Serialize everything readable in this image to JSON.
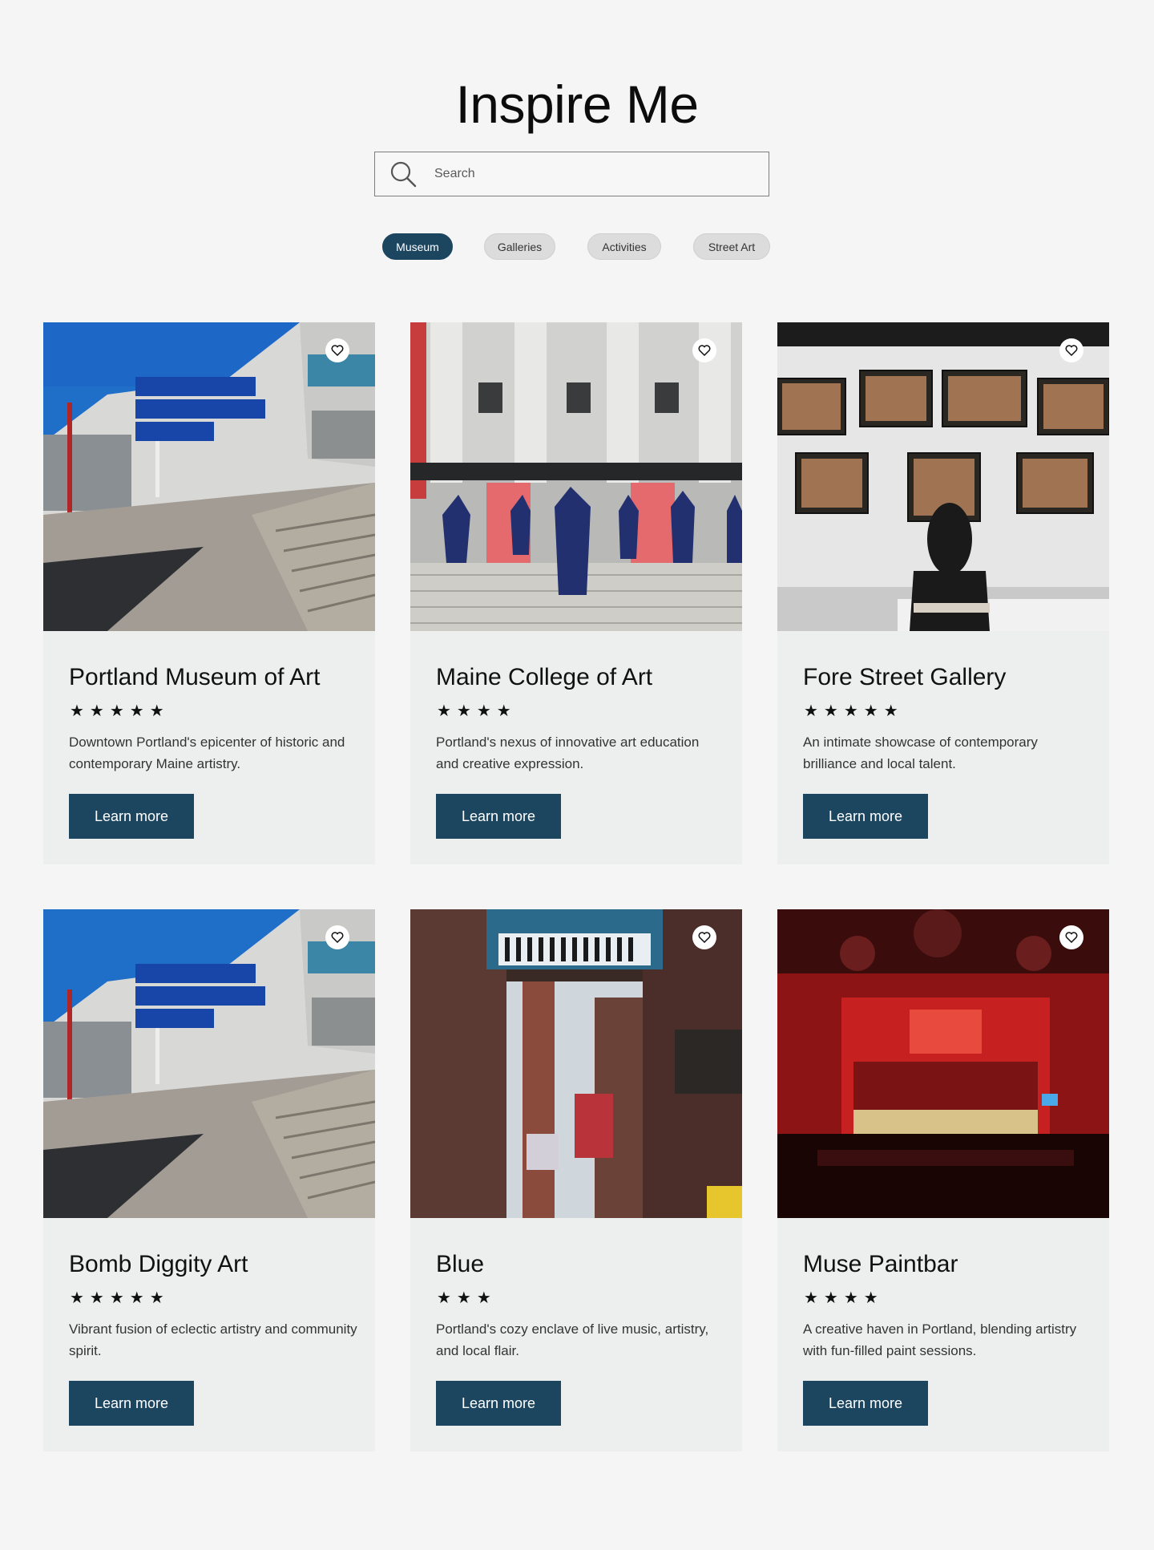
{
  "title": "Inspire Me",
  "search": {
    "placeholder": "Search"
  },
  "filters": [
    "Museum",
    "Galleries",
    "Activities",
    "Street Art"
  ],
  "active_filter": "Museum",
  "cards": [
    {
      "title": "Portland Museum of Art",
      "rating": 5,
      "stars": "★★★★★",
      "description": "Downtown Portland's epicenter of historic and contemporary Maine artistry.",
      "button": "Learn more",
      "image": "building-with-sign"
    },
    {
      "title": "Maine College of Art",
      "rating": 4,
      "stars": "★★★★",
      "description": "Portland's nexus of innovative art education and creative expression.",
      "button": "Learn more",
      "image": "graduates-on-steps"
    },
    {
      "title": "Fore Street Gallery",
      "rating": 5,
      "stars": "★★★★★",
      "description": "An intimate showcase of contemporary brilliance and local talent.",
      "button": "Learn more",
      "image": "gallery-wall"
    },
    {
      "title": "Bomb Diggity Art",
      "rating": 5,
      "stars": "★★★★★",
      "description": "Vibrant fusion of eclectic artistry and community spirit.",
      "button": "Learn more",
      "image": "building-with-sign"
    },
    {
      "title": "Blue",
      "rating": 3,
      "stars": "★★★",
      "description": "Portland's cozy enclave of live music, artistry, and local flair.",
      "button": "Learn more",
      "image": "alley-with-signs"
    },
    {
      "title": "Muse Paintbar",
      "rating": 4,
      "stars": "★★★★",
      "description": "A creative haven in Portland, blending artistry with fun-filled paint sessions.",
      "button": "Learn more",
      "image": "red-bar"
    }
  ],
  "colors": {
    "accent": "#1c4560",
    "card_bg": "#edefee",
    "page_bg": "#f5f5f5"
  }
}
